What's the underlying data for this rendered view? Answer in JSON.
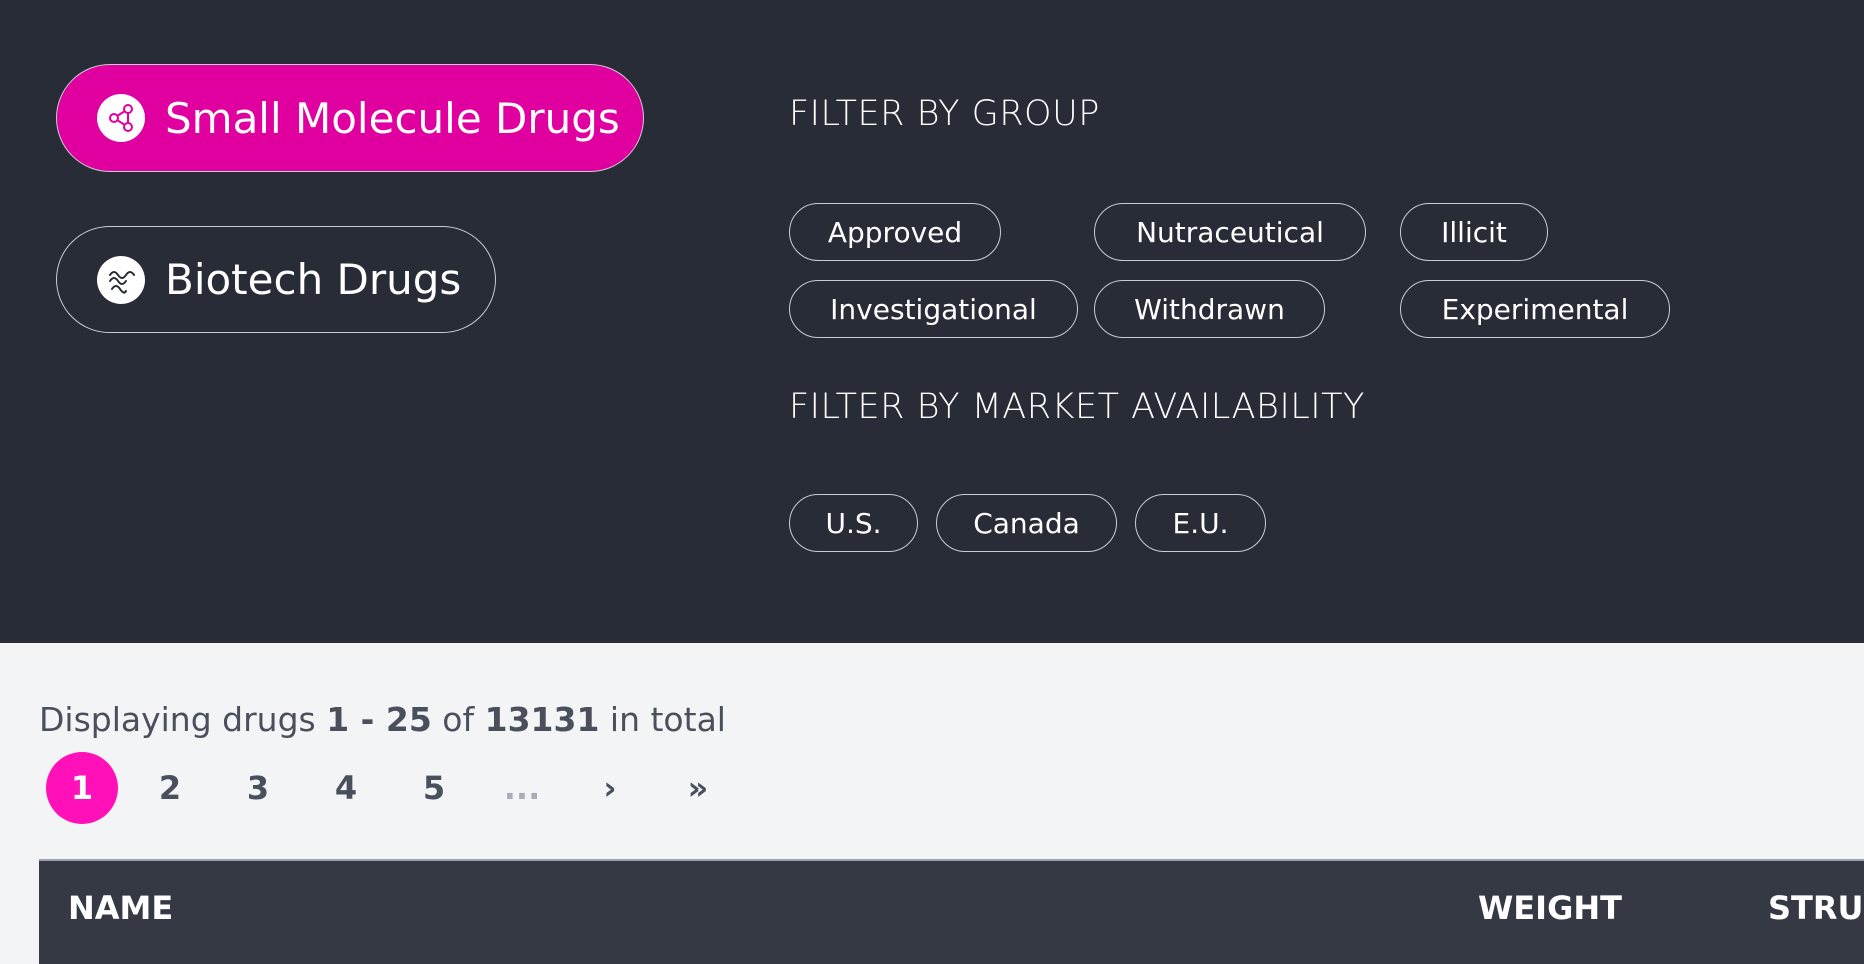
{
  "drug_types": {
    "small_molecule": {
      "label": "Small Molecule Drugs",
      "icon": "molecule-icon"
    },
    "biotech": {
      "label": "Biotech Drugs",
      "icon": "protein-coil-icon"
    }
  },
  "filters": {
    "group_title": "FILTER BY GROUP",
    "groups": [
      "Approved",
      "Nutraceutical",
      "Illicit",
      "Investigational",
      "Withdrawn",
      "Experimental"
    ],
    "market_title": "FILTER BY MARKET AVAILABILITY",
    "markets": [
      "U.S.",
      "Canada",
      "E.U."
    ]
  },
  "summary": {
    "prefix": "Displaying drugs",
    "range": "1 - 25",
    "of": "of",
    "total": "13131",
    "suffix": "in total"
  },
  "pagination": {
    "pages": [
      "1",
      "2",
      "3",
      "4",
      "5"
    ],
    "active": "1",
    "ellipsis": "...",
    "next": "›",
    "last": "»"
  },
  "table": {
    "columns": [
      "NAME",
      "WEIGHT",
      "STRUC"
    ]
  },
  "colors": {
    "accent": "#e000a0",
    "page_active": "#ff10b8",
    "header_bg": "#282c36",
    "table_header_bg": "#353944"
  }
}
